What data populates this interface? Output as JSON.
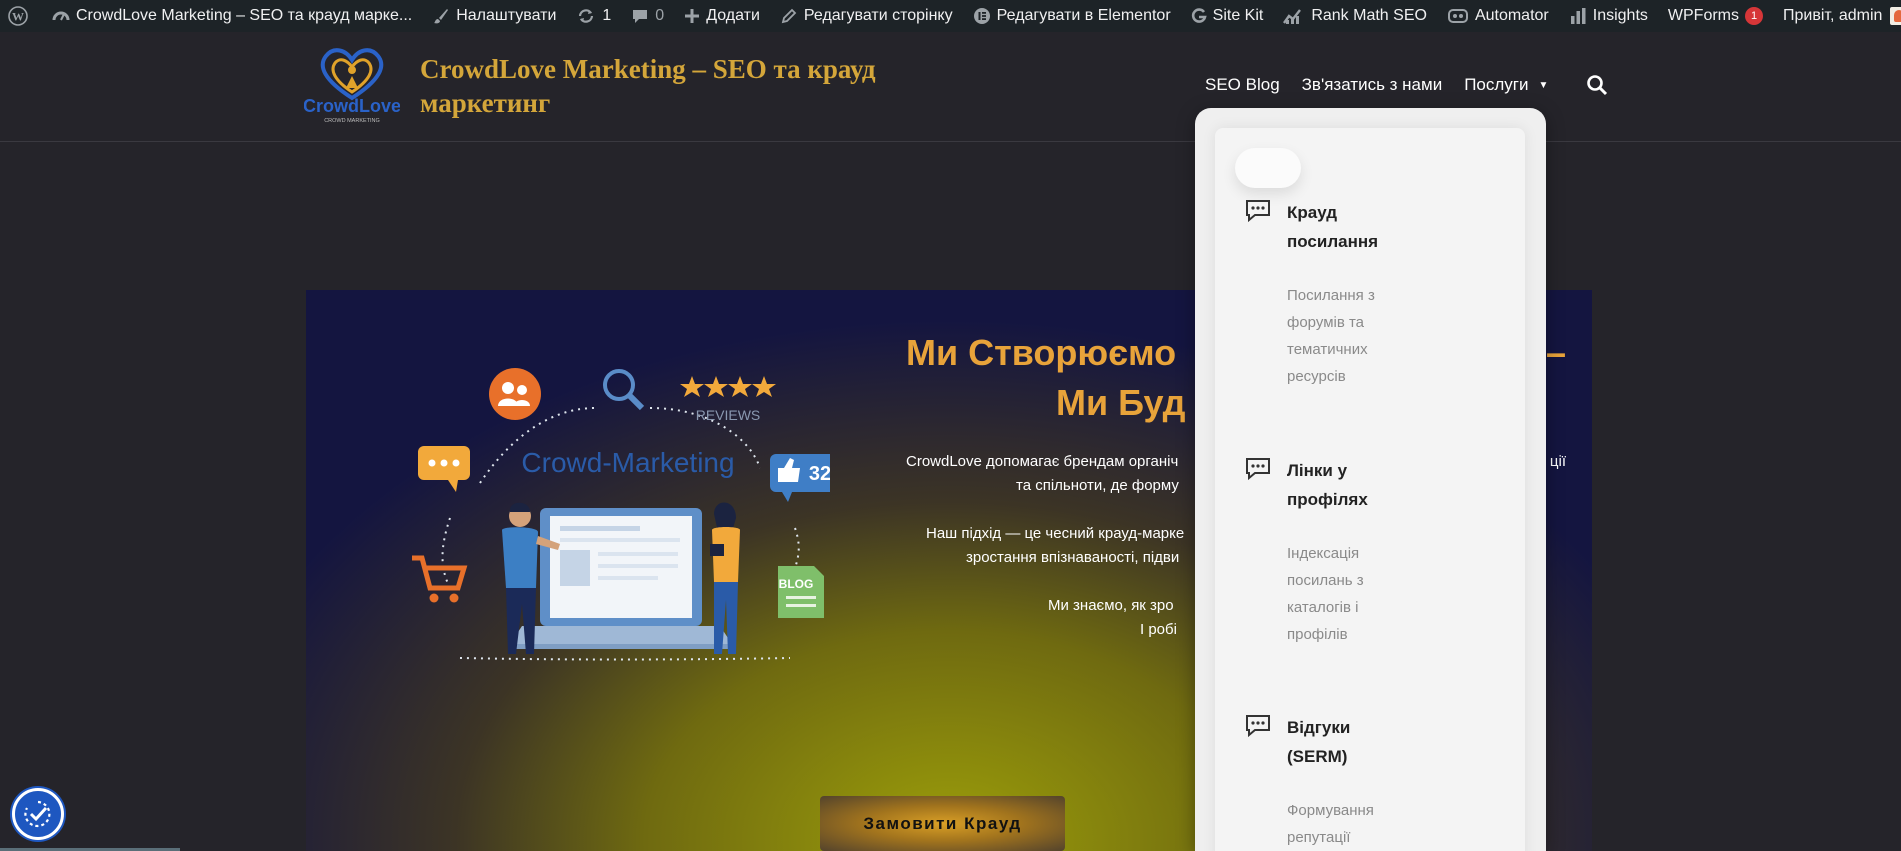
{
  "adminbar": {
    "site_name": "CrowdLove Marketing – SEO та крауд марке...",
    "customize": "Налаштувати",
    "updates_count": "1",
    "comments_count": "0",
    "add_new": "Додати",
    "edit_page": "Редагувати сторінку",
    "edit_elementor": "Редагувати в Elementor",
    "site_kit": "Site Kit",
    "rank_math": "Rank Math SEO",
    "automator": "Automator",
    "insights": "Insights",
    "wpforms": "WPForms",
    "wpforms_badge": "1",
    "greeting": "Привіт, admin"
  },
  "header": {
    "logo_text": "CrowdLove",
    "logo_subtext": "CROWD MARKETING",
    "site_title": "CrowdLove Marketing – SEO та крауд маркетинг",
    "nav": {
      "seo_blog": "SEO Blog",
      "contact": "Зв'язатись з нами",
      "services": "Послуги"
    }
  },
  "hero": {
    "illustration": {
      "reviews_label": "REVIEWS",
      "crowd_label": "Crowd-Marketing",
      "likes_count": "32",
      "blog_label": "BLOG"
    },
    "heading_line1": "Ми Створюємо",
    "heading_line1_end": "–",
    "heading_line2": "Ми Буд",
    "para1_line1": "CrowdLove допомагає брендам органіч",
    "para1_line1_end": "ції",
    "para1_line2": "та спільноти, де форму",
    "para2_line1": "Наш підхід — це чесний крауд-марке",
    "para2_line2": "зростання впізнаваності, підви",
    "para3_line1": "Ми знаємо, як зро",
    "para3_line2": "І робі",
    "cta": "Замовити Крауд"
  },
  "dropdown": {
    "items": [
      {
        "title_line1": "Крауд",
        "title_line2": "посилання",
        "desc": [
          "Посилання з",
          "форумів та",
          "тематичних",
          "ресурсів"
        ]
      },
      {
        "title_line1": "Лінки у",
        "title_line2": "профілях",
        "desc": [
          "Індексація",
          "посилань з",
          "каталогів і",
          "профілів"
        ]
      },
      {
        "title_line1": "Відгуки",
        "title_line2": "(SERM)",
        "desc": [
          "Формування",
          "репутації"
        ]
      }
    ]
  },
  "colors": {
    "accent_gold": "#d4a63a",
    "heading_orange": "#e8a33a",
    "adminbar_bg": "#1d2327",
    "page_bg": "#25242a",
    "badge_red": "#d63638",
    "a11y_blue": "#1e57c0"
  },
  "icons": [
    "wordpress-icon",
    "dashboard-icon",
    "brush-icon",
    "refresh-icon",
    "comment-icon",
    "plus-icon",
    "pencil-icon",
    "elementor-icon",
    "google-icon",
    "rankmath-icon",
    "automator-icon",
    "bar-chart-icon",
    "search-icon",
    "chat-bubble-icon",
    "accessibility-icon"
  ]
}
